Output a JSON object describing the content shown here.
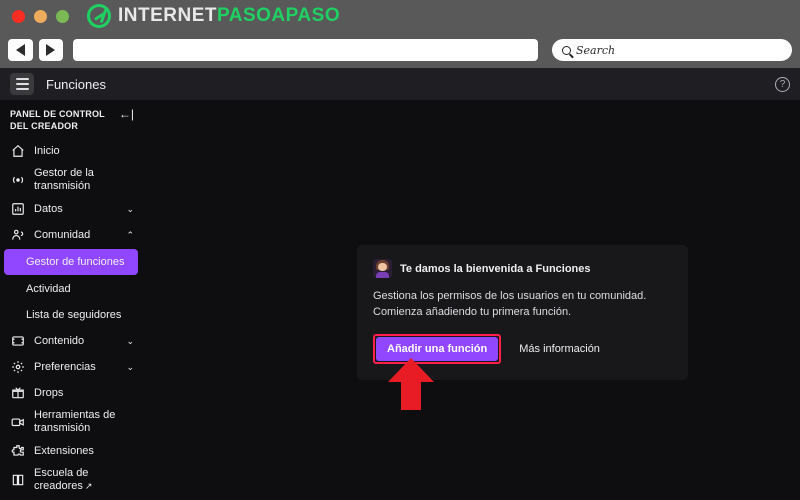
{
  "browser": {
    "traffic_lights": [
      "close-red",
      "minimize-amber",
      "maximize-green"
    ],
    "brand": {
      "part1": "INTERNET",
      "part2": "PASOAPASO"
    },
    "back_label": "◀",
    "forward_label": "▶",
    "url_value": "",
    "url_placeholder": "",
    "search_placeholder": "Search",
    "search_value": "Search"
  },
  "page_header": {
    "menu_icon": "hamburger-icon",
    "title": "Funciones",
    "help_icon": "?"
  },
  "sidebar": {
    "title": "PANEL DE CONTROL DEL CREADOR",
    "collapse_icon": "collapse-left-icon",
    "items": [
      {
        "label": "Inicio",
        "icon": "home-icon",
        "chevron": "",
        "active": false,
        "sub": false,
        "external": false
      },
      {
        "label": "Gestor de la transmisión",
        "icon": "broadcast-icon",
        "chevron": "",
        "active": false,
        "sub": false,
        "external": false
      },
      {
        "label": "Datos",
        "icon": "chart-icon",
        "chevron": "⌄",
        "active": false,
        "sub": false,
        "external": false
      },
      {
        "label": "Comunidad",
        "icon": "community-icon",
        "chevron": "⌃",
        "active": false,
        "sub": false,
        "external": false
      },
      {
        "label": "Gestor de funciones",
        "icon": "",
        "chevron": "",
        "active": true,
        "sub": true,
        "external": false
      },
      {
        "label": "Actividad",
        "icon": "",
        "chevron": "",
        "active": false,
        "sub": true,
        "external": false
      },
      {
        "label": "Lista de seguidores",
        "icon": "",
        "chevron": "",
        "active": false,
        "sub": true,
        "external": false
      },
      {
        "label": "Contenido",
        "icon": "content-icon",
        "chevron": "⌄",
        "active": false,
        "sub": false,
        "external": false
      },
      {
        "label": "Preferencias",
        "icon": "gear-icon",
        "chevron": "⌄",
        "active": false,
        "sub": false,
        "external": false
      },
      {
        "label": "Drops",
        "icon": "gift-icon",
        "chevron": "",
        "active": false,
        "sub": false,
        "external": false
      },
      {
        "label": "Herramientas de transmisión",
        "icon": "video-camera-icon",
        "chevron": "",
        "active": false,
        "sub": false,
        "external": false
      },
      {
        "label": "Extensiones",
        "icon": "puzzle-icon",
        "chevron": "",
        "active": false,
        "sub": false,
        "external": false
      },
      {
        "label": "Escuela de creadores",
        "icon": "book-icon",
        "chevron": "",
        "active": false,
        "sub": false,
        "external": true
      }
    ]
  },
  "modal": {
    "avatar_icon": "waving-person-avatar",
    "title": "Te damos la bienvenida a Funciones",
    "body": "Gestiona los permisos de los usuarios en tu comunidad. Comienza añadiendo tu primera función.",
    "primary_button": "Añadir una función",
    "secondary_link": "Más información"
  },
  "annotation": {
    "arrow": "red-up-arrow",
    "highlight": "red-rectangle-around-primary-button"
  },
  "colors": {
    "accent_purple": "#9147ff",
    "annotation_red": "#e81c24",
    "highlight_magenta": "#ff1f4b",
    "brand_green": "#1fd163",
    "page_bg": "#0e0e10",
    "modal_bg": "#18181b",
    "chrome_gray": "#595959"
  }
}
